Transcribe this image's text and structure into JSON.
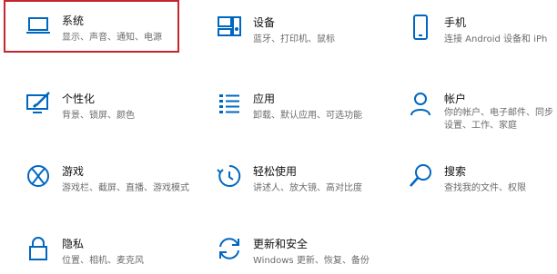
{
  "settings": {
    "accent_color": "#0067c0",
    "highlight_color": "#c4262c",
    "tiles": [
      {
        "id": "system",
        "icon": "laptop-icon",
        "title": "系统",
        "desc": "显示、声音、通知、电源",
        "selected": true
      },
      {
        "id": "devices",
        "icon": "devices-icon",
        "title": "设备",
        "desc": "蓝牙、打印机、鼠标"
      },
      {
        "id": "phone",
        "icon": "phone-icon",
        "title": "手机",
        "desc": "连接 Android 设备和 iPh"
      },
      {
        "id": "personalization",
        "icon": "personalization-icon",
        "title": "个性化",
        "desc": "背景、锁屏、颜色"
      },
      {
        "id": "apps",
        "icon": "apps-list-icon",
        "title": "应用",
        "desc": "卸载、默认应用、可选功能"
      },
      {
        "id": "accounts",
        "icon": "person-icon",
        "title": "帐户",
        "desc": "你的帐户、电子邮件、同步设置、工作、家庭"
      },
      {
        "id": "gaming",
        "icon": "xbox-icon",
        "title": "游戏",
        "desc": "游戏栏、截屏、直播、游戏模式"
      },
      {
        "id": "ease",
        "icon": "ease-of-access-icon",
        "title": "轻松使用",
        "desc": "讲述人、放大镜、高对比度"
      },
      {
        "id": "search",
        "icon": "search-icon",
        "title": "搜索",
        "desc": "查找我的文件、权限"
      },
      {
        "id": "privacy",
        "icon": "lock-icon",
        "title": "隐私",
        "desc": "位置、相机、麦克风"
      },
      {
        "id": "update",
        "icon": "update-icon",
        "title": "更新和安全",
        "desc": "Windows 更新、恢复、备份"
      }
    ]
  }
}
